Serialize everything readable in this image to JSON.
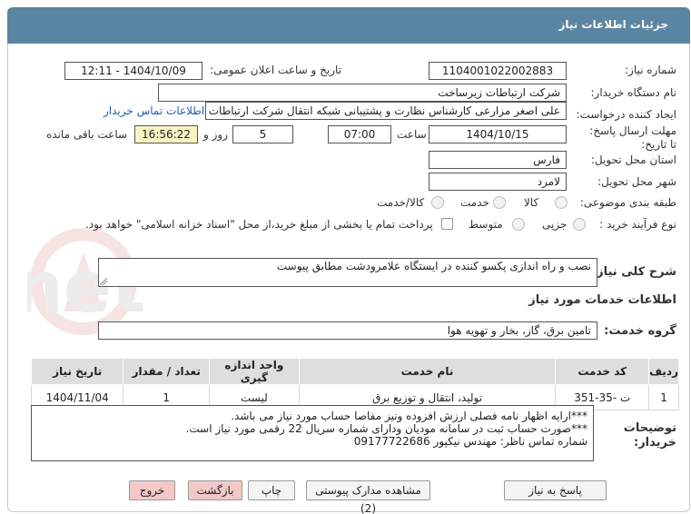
{
  "header": {
    "title": "جزئیات اطلاعات نیاز"
  },
  "fields": {
    "need_number_label": "شماره نیاز:",
    "need_number": "1104001022002883",
    "announce_label": "تاریخ و ساعت اعلان عمومی:",
    "announce_value": "1404/10/09 - 12:11",
    "buyer_org_label": "نام دستگاه خریدار:",
    "buyer_org": "شرکت ارتباطات زیرساخت",
    "creator_label": "ایجاد کننده درخواست:",
    "creator": "علی اصغر مزارعی کارشناس نظارت و پشتیبانی شبکه انتقال شرکت ارتباطات زیرساخت",
    "contact_link": "اطلاعات تماس خریدار",
    "deadline_label": "مهلت ارسال پاسخ: تا تاریخ:",
    "deadline_date": "1404/10/15",
    "time_label": "ساعت",
    "deadline_time": "07:00",
    "days": "5",
    "days_label": "روز و",
    "remaining": "16:56:22",
    "remaining_label": "ساعت باقی مانده",
    "province_label": "استان محل تحویل:",
    "province": "فارس",
    "city_label": "شهر محل تحویل:",
    "city": "لامرد",
    "category_label": "طبقه بندی موضوعی:",
    "category_options": [
      "کالا",
      "خدمت",
      "کالا/خدمت"
    ],
    "process_label": "نوع فرآیند خرید :",
    "process_options": [
      "جزیی",
      "متوسط"
    ],
    "payment_text": "پرداخت تمام یا بخشی از مبلغ خرید،از محل \"اسناد خزانه اسلامی\" خواهد بود."
  },
  "summary": {
    "label": "شرح کلی نیاز:",
    "value": "نصب و راه اندازی پکسو کننده در ایستگاه علامرودشت مطابق پیوست"
  },
  "services": {
    "section_title": "اطلاعات خدمات مورد نیاز",
    "group_label": "گروه خدمت:",
    "group_value": "تامین برق، گاز، بخار و تهویه هوا"
  },
  "table": {
    "headers": [
      "ردیف",
      "کد خدمت",
      "نام خدمت",
      "واحد اندازه گیری",
      "تعداد / مقدار",
      "تاریخ نیاز"
    ],
    "rows": [
      [
        "1",
        "ت -35-351",
        "تولید، انتقال و توزیع برق",
        "لیست",
        "1",
        "1404/11/04"
      ]
    ]
  },
  "notes": {
    "label": "توضیحات خریدار:",
    "lines": [
      "***ارایه اظهار نامه فصلی ارزش افزوده  ونیز مفاصا حساب مورد نیاز می باشد.",
      "***صورت حساب ثبت در سامانه مودیان ودارای شماره سریال 22 رقمی مورد نیاز است.",
      "شماره تماس ناظر: مهندس نیکپور 09177722686"
    ]
  },
  "buttons": {
    "reply": "پاسخ به نیاز",
    "attachments": "مشاهده مدارک پیوستی (2)",
    "print": "چاپ",
    "back": "بازگشت",
    "exit": "خروج"
  },
  "watermark": {
    "text": "AriaTender.net"
  },
  "colors": {
    "header": "#5b86a3",
    "link": "#1a5fb4",
    "highlight": "#fbf3c4",
    "pink_button": "#f3c8c8"
  }
}
